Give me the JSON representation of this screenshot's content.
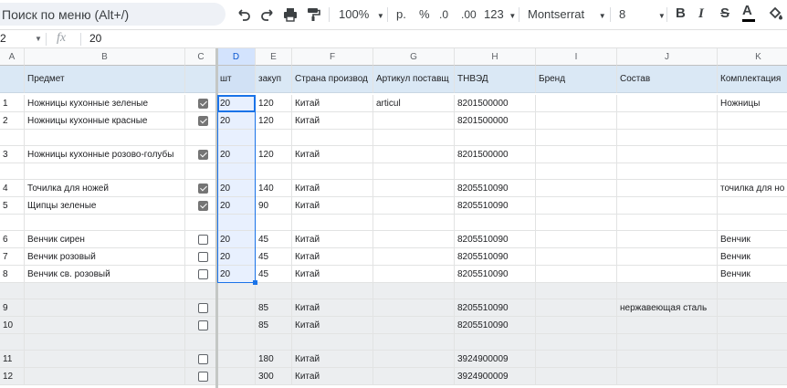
{
  "toolbar": {
    "search_label": "Поиск по меню (Alt+/)",
    "zoom": "100%",
    "currency": "р.",
    "percent": "%",
    "decrease_decimals": ".0",
    "increase_decimals": ".00",
    "number_format": "123",
    "font_name": "Montserrat",
    "font_size": "8",
    "bold": "B",
    "italic": "I",
    "strike": "S",
    "text_color": "A"
  },
  "formula_bar": {
    "name_box": "2",
    "fx": "fx",
    "value": "20"
  },
  "columns": [
    "A",
    "B",
    "C",
    "D",
    "E",
    "F",
    "G",
    "H",
    "I",
    "J",
    "K"
  ],
  "header_row": [
    "",
    "Предмет",
    "",
    "шт",
    "закуп",
    "Страна производ",
    "Артикул поставщ",
    "ТНВЭД",
    "Бренд",
    "Состав",
    "Комплектация"
  ],
  "rows": [
    {
      "cells": [
        "1",
        "Ножницы кухонные зеленые",
        "checked",
        "20",
        "120",
        "Китай",
        "articul",
        "8201500000",
        "",
        "",
        "Ножницы"
      ]
    },
    {
      "cells": [
        "2",
        "Ножницы кухонные красные",
        "checked",
        "20",
        "120",
        "Китай",
        "",
        "8201500000",
        "",
        "",
        ""
      ]
    },
    {
      "cells": [
        "",
        "",
        "",
        "",
        "",
        "",
        "",
        "",
        "",
        "",
        ""
      ]
    },
    {
      "cells": [
        "3",
        "Ножницы кухонные розово-голубы",
        "checked",
        "20",
        "120",
        "Китай",
        "",
        "8201500000",
        "",
        "",
        ""
      ]
    },
    {
      "cells": [
        "",
        "",
        "",
        "",
        "",
        "",
        "",
        "",
        "",
        "",
        ""
      ]
    },
    {
      "cells": [
        "4",
        "Точилка для ножей",
        "checked",
        "20",
        "140",
        "Китай",
        "",
        "8205510090",
        "",
        "",
        "точилка для но"
      ]
    },
    {
      "cells": [
        "5",
        "Щипцы зеленые",
        "checked",
        "20",
        "90",
        "Китай",
        "",
        "8205510090",
        "",
        "",
        ""
      ]
    },
    {
      "cells": [
        "",
        "",
        "",
        "",
        "",
        "",
        "",
        "",
        "",
        "",
        ""
      ]
    },
    {
      "cells": [
        "6",
        "Венчик сирен",
        "unchecked",
        "20",
        "45",
        "Китай",
        "",
        "8205510090",
        "",
        "",
        "Венчик"
      ]
    },
    {
      "cells": [
        "7",
        "Венчик розовый",
        "unchecked",
        "20",
        "45",
        "Китай",
        "",
        "8205510090",
        "",
        "",
        "Венчик"
      ]
    },
    {
      "cells": [
        "8",
        "Венчик св. розовый",
        "unchecked",
        "20",
        "45",
        "Китай",
        "",
        "8205510090",
        "",
        "",
        "Венчик"
      ]
    },
    {
      "cells": [
        "",
        "",
        "",
        "",
        "",
        "",
        "",
        "",
        "",
        "",
        ""
      ]
    },
    {
      "cells": [
        "9",
        "",
        "unchecked",
        "",
        "85",
        "Китай",
        "",
        "8205510090",
        "",
        "нержавеющая сталь",
        ""
      ]
    },
    {
      "cells": [
        "10",
        "",
        "unchecked",
        "",
        "85",
        "Китай",
        "",
        "8205510090",
        "",
        "",
        ""
      ]
    },
    {
      "cells": [
        "",
        "",
        "",
        "",
        "",
        "",
        "",
        "",
        "",
        "",
        ""
      ]
    },
    {
      "cells": [
        "11",
        "",
        "unchecked",
        "",
        "180",
        "Китай",
        "",
        "3924900009",
        "",
        "",
        ""
      ]
    },
    {
      "cells": [
        "12",
        "",
        "unchecked",
        "",
        "300",
        "Китай",
        "",
        "3924900009",
        "",
        "",
        ""
      ]
    }
  ],
  "colors": {
    "accent": "#1a73e8",
    "header_fill": "#dae8f5",
    "gray_fill": "#eceef0"
  }
}
